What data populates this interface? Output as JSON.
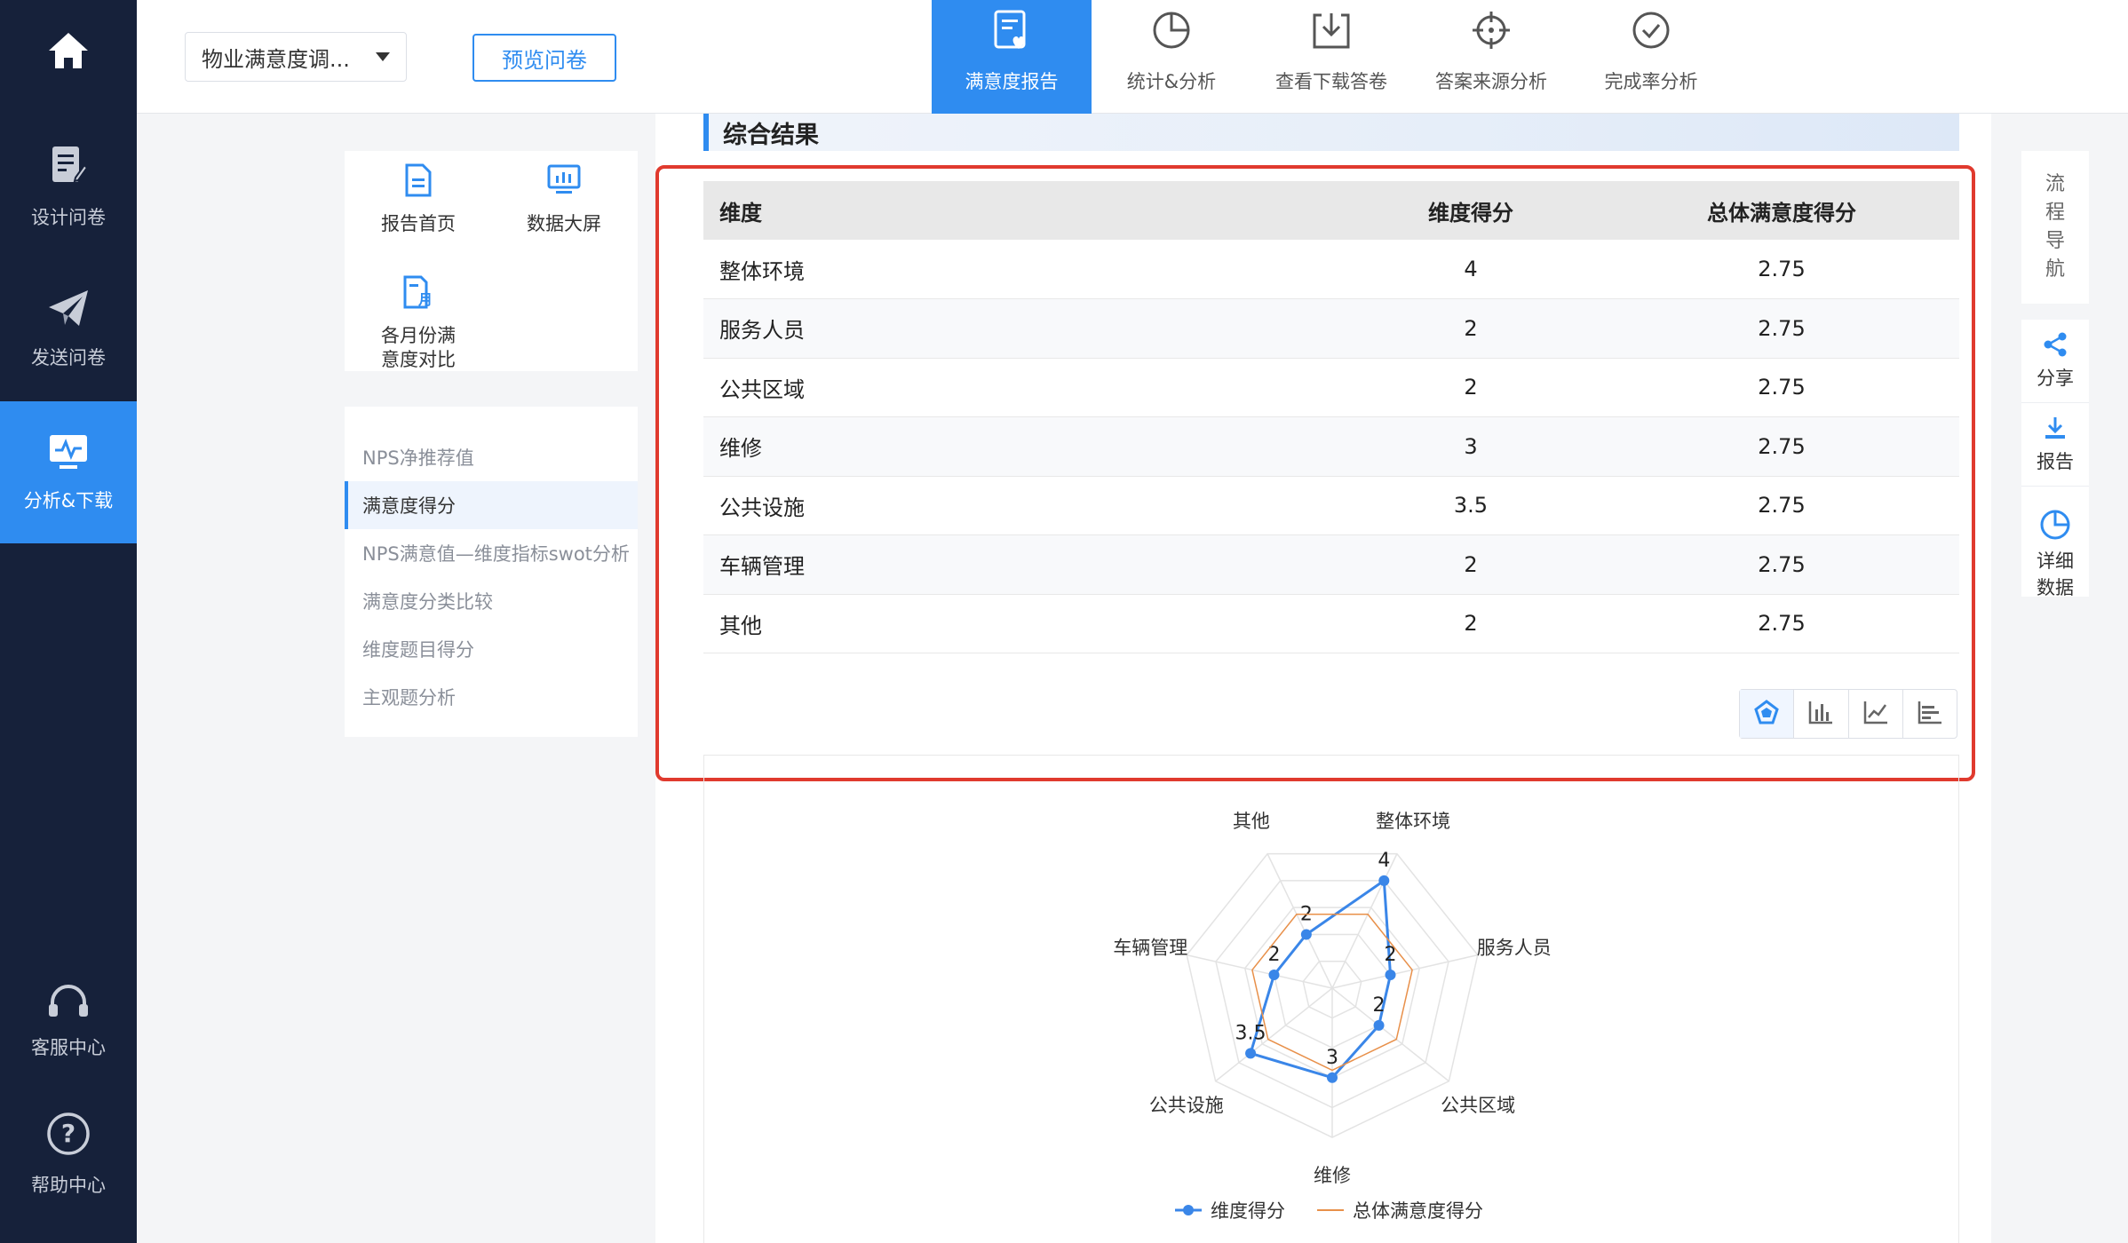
{
  "sidebar": {
    "home_icon": "home-icon",
    "items": [
      {
        "label": "设计问卷",
        "icon": "edit-doc-icon"
      },
      {
        "label": "发送问卷",
        "icon": "paper-plane-icon"
      },
      {
        "label": "分析&下载",
        "icon": "monitor-chart-icon",
        "active": true
      },
      {
        "label": "客服中心",
        "icon": "headset-icon"
      },
      {
        "label": "帮助中心",
        "icon": "question-icon"
      }
    ]
  },
  "topbar": {
    "survey_select": "物业满意度调...",
    "preview_button": "预览问卷",
    "tabs": [
      {
        "label": "满意度报告",
        "icon": "report-heart-icon",
        "active": true
      },
      {
        "label": "统计&分析",
        "icon": "pie-icon"
      },
      {
        "label": "查看下载答卷",
        "icon": "download-icon"
      },
      {
        "label": "答案来源分析",
        "icon": "crosshair-icon"
      },
      {
        "label": "完成率分析",
        "icon": "check-circle-icon"
      }
    ]
  },
  "quick_links": [
    {
      "label": "报告首页",
      "icon": "doc-icon"
    },
    {
      "label": "数据大屏",
      "icon": "screen-icon"
    },
    {
      "label": "各月份满\n意度对比",
      "icon": "calendar-doc-icon"
    }
  ],
  "report_menu": [
    {
      "label": "NPS净推荐值"
    },
    {
      "label": "满意度得分",
      "active": true
    },
    {
      "label": "NPS满意值—维度指标swot分析"
    },
    {
      "label": "满意度分类比较"
    },
    {
      "label": "维度题目得分"
    },
    {
      "label": "主观题分析"
    }
  ],
  "section": {
    "title": "综合结果"
  },
  "table": {
    "headers": [
      "维度",
      "维度得分",
      "总体满意度得分"
    ],
    "rows": [
      [
        "整体环境",
        "4",
        "2.75"
      ],
      [
        "服务人员",
        "2",
        "2.75"
      ],
      [
        "公共区域",
        "2",
        "2.75"
      ],
      [
        "维修",
        "3",
        "2.75"
      ],
      [
        "公共设施",
        "3.5",
        "2.75"
      ],
      [
        "车辆管理",
        "2",
        "2.75"
      ],
      [
        "其他",
        "2",
        "2.75"
      ]
    ]
  },
  "chart_switch": [
    "radar-chart-icon",
    "bar-chart-icon",
    "line-chart-icon",
    "hbar-chart-icon"
  ],
  "chart_data": {
    "type": "radar",
    "indicators": [
      "整体环境",
      "服务人员",
      "公共区域",
      "维修",
      "公共设施",
      "车辆管理",
      "其他"
    ],
    "series": [
      {
        "name": "维度得分",
        "values": [
          4,
          2,
          2,
          3,
          3.5,
          2,
          2
        ],
        "color": "#3a86e8"
      },
      {
        "name": "总体满意度得分",
        "values": [
          2.75,
          2.75,
          2.75,
          2.75,
          2.75,
          2.75,
          2.75
        ],
        "color": "#e8904a"
      }
    ],
    "max": 5,
    "legend": "bottom"
  },
  "right_tools": [
    {
      "label": "流\n程\n导\n航"
    },
    {
      "label": "分享",
      "icon": "share-icon"
    },
    {
      "label": "报告",
      "icon": "download-icon"
    },
    {
      "label": "详细\n数据",
      "icon": "pie-icon"
    }
  ]
}
